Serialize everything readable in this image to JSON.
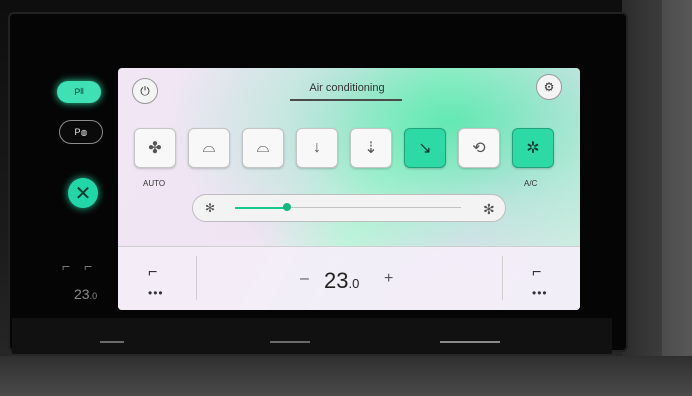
{
  "screen": {
    "title": "Air conditioning",
    "power_icon": "power-icon",
    "settings_icon": "gear-icon"
  },
  "left_panel": {
    "park_assist_label": "P",
    "park_assist_icon": "parking-sensor-icon",
    "park_camera_label": "P",
    "park_camera_icon": "camera-icon",
    "close_icon": "close-icon",
    "seat_icons": [
      "seat-heat-icon",
      "seat-vent-icon"
    ],
    "temp_main": "23",
    "temp_decimal": ".0",
    "power_icon": "power-icon"
  },
  "modes": [
    {
      "icon": "fan-icon",
      "label": "AUTO",
      "active": false
    },
    {
      "icon": "windshield-defrost-icon",
      "label": "",
      "active": false
    },
    {
      "icon": "defrost-body-icon",
      "label": "",
      "active": false
    },
    {
      "icon": "airflow-feet-icon",
      "label": "",
      "active": false
    },
    {
      "icon": "airflow-body-feet-icon",
      "label": "",
      "active": false
    },
    {
      "icon": "airflow-body-icon",
      "label": "",
      "active": true
    },
    {
      "icon": "recirculation-icon",
      "label": "",
      "active": false
    },
    {
      "icon": "ac-snowflake-icon",
      "label": "A/C",
      "active": true
    }
  ],
  "fan_speed": {
    "level_fraction": 0.23,
    "min_icon": "fan-low-icon",
    "max_icon": "fan-high-icon"
  },
  "bottom": {
    "temperature_main": "23",
    "temperature_decimal": ".0",
    "minus_label": "–",
    "plus_label": "+",
    "left_seat_icon": "seat-heat-icon",
    "right_seat_icon": "seat-heat-icon",
    "dots": "•••"
  },
  "colors": {
    "accent": "#2ddaa6",
    "bezel": "#050505"
  }
}
